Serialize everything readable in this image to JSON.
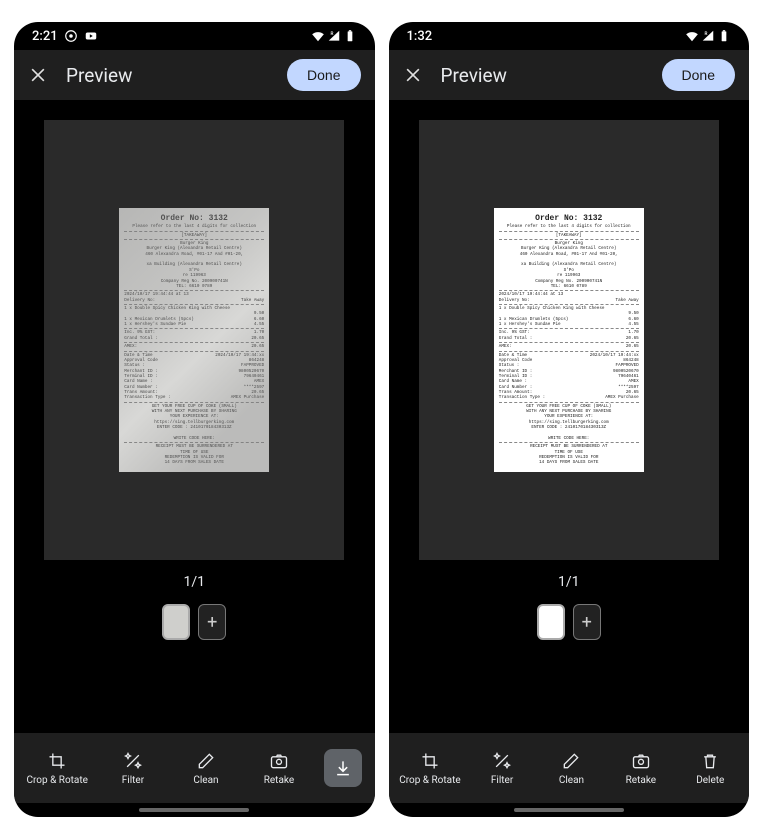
{
  "left": {
    "status": {
      "time": "2:21"
    },
    "header": {
      "title": "Preview",
      "done": "Done"
    },
    "counter": "1/1",
    "thumbs": {
      "add": "+"
    },
    "toolbar": {
      "crop": "Crop & Rotate",
      "filter": "Filter",
      "clean": "Clean",
      "retake": "Retake"
    }
  },
  "right": {
    "status": {
      "time": "1:32"
    },
    "header": {
      "title": "Preview",
      "done": "Done"
    },
    "counter": "1/1",
    "thumbs": {
      "add": "+"
    },
    "toolbar": {
      "crop": "Crop & Rotate",
      "filter": "Filter",
      "clean": "Clean",
      "retake": "Retake",
      "delete": "Delete"
    }
  },
  "receipt": {
    "order_label": "Order No: 3132",
    "subhead": "Please refer to the last 4 digits for collection",
    "mode": "[TAKEAWAY]",
    "store": "Burger King",
    "store2": "Burger King (Alexandra Retail Centre)",
    "addr": "460 Alexandra Road, #01-17 And #01-20,",
    "building": "xa Building (Alexandra Retail Centre)",
    "city": "S'Po",
    "postal": "re 119963",
    "company": "Company Reg No. 200900741N",
    "tel": "TEL: 6610 0789",
    "datetime_line": "2024/10/17 19:44:44 at 13",
    "delivery_label": "Delivery No:",
    "delivery_val": "Take Away",
    "item1": "1 x Double Spicy Chicken King with Cheese",
    "item1_price": "9.50",
    "item2": "1 x Mexican Drumlets (5pcs)",
    "item2_price": "6.60",
    "item3": "1 x Hershey's Sundae Pie",
    "item3_price": "4.55",
    "gst_label": "Inc. 9% GST:",
    "gst_val": "1.70",
    "total_label": "Grand Total :",
    "total_val": "20.65",
    "amex_label": "AMEX:",
    "amex_val": "20.65",
    "dt_label": "Date & Time",
    "dt_val": "2024/10/17 19:44:xx",
    "appr_label": "Approval Code",
    "appr_val": "864248",
    "status_label": "Status :",
    "status_val": "FAPPROVED",
    "merchant_label": "Merchant ID :",
    "merchant_val": "9800520670",
    "terminal_label": "Terminal ID :",
    "terminal_val": "79640461",
    "card_name_label": "Card Name :",
    "card_name_val": "AMEX",
    "card_num_label": "Card Number :",
    "card_num_val": "****2597",
    "trans_label": "Trans Amount:",
    "trans_val": "20.65",
    "ttype_label": "Transaction Type :",
    "ttype_val": "AMEX Purchase",
    "promo1": "GET YOUR FREE CUP OF COKE (SMALL)",
    "promo2": "WITH ANY NEXT PURCHASE BY SHARING",
    "promo3": "YOUR EXPERIENCE AT:",
    "promo4": "https://sing.tellburgerking.com",
    "promo5": "ENTER CODE : 241017018430313Z",
    "write": "WRITE CODE HERE:",
    "foot1": "RECEIPT MUST BE SURRENDERED AT",
    "foot2": "TIME OF USE",
    "foot3": "REDEMPTION IS VALID FOR",
    "foot4": "14 DAYS FROM SALES DATE"
  }
}
